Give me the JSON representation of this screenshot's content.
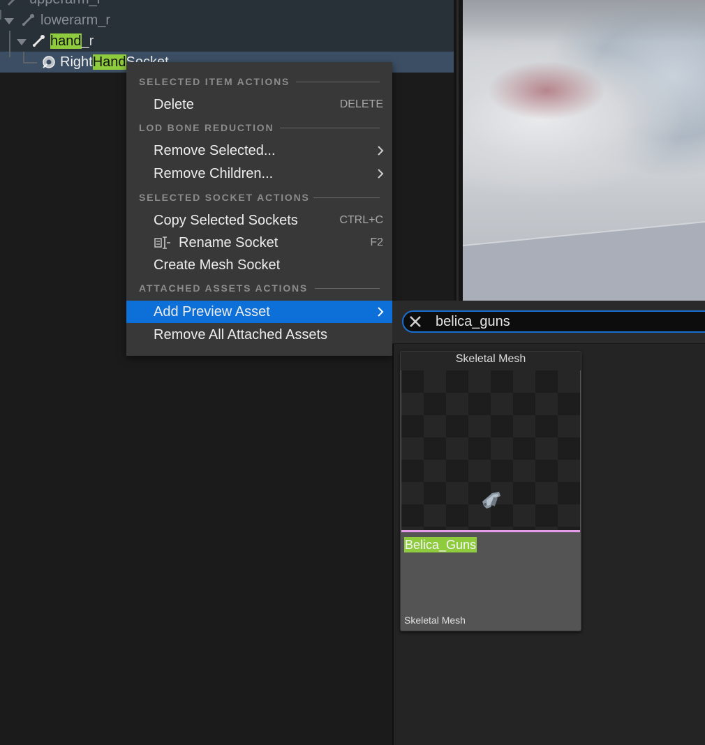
{
  "skeleton_tree": {
    "rows": [
      {
        "label": "upperarm_r"
      },
      {
        "label": "lowerarm_r"
      },
      {
        "prefix": "",
        "highlight": "hand",
        "suffix": "_r"
      },
      {
        "prefix": "Right",
        "highlight": "Hand",
        "suffix": "Socket"
      }
    ]
  },
  "context_menu": {
    "sections": {
      "selected_item": "SELECTED ITEM ACTIONS",
      "lod": "LOD BONE REDUCTION",
      "socket": "SELECTED SOCKET ACTIONS",
      "attached": "ATTACHED ASSETS ACTIONS"
    },
    "items": {
      "delete": {
        "label": "Delete",
        "shortcut": "DELETE"
      },
      "remove_selected": {
        "label": "Remove Selected..."
      },
      "remove_children": {
        "label": "Remove Children..."
      },
      "copy_sockets": {
        "label": "Copy Selected Sockets",
        "shortcut": "CTRL+C"
      },
      "rename_socket": {
        "label": "Rename Socket",
        "shortcut": "F2"
      },
      "create_mesh_socket": {
        "label": "Create Mesh Socket"
      },
      "add_preview_asset": {
        "label": "Add Preview Asset"
      },
      "remove_attached": {
        "label": "Remove All Attached Assets"
      }
    }
  },
  "asset_picker": {
    "search_value": "belica_guns",
    "tile": {
      "type_header": "Skeletal Mesh",
      "name": "Belica_Guns",
      "type_footer": "Skeletal Mesh"
    }
  },
  "colors": {
    "accent": "#0d70d9",
    "search_highlight": "#8fcc3d",
    "skeletal_mesh_bar": "#e49be8"
  }
}
